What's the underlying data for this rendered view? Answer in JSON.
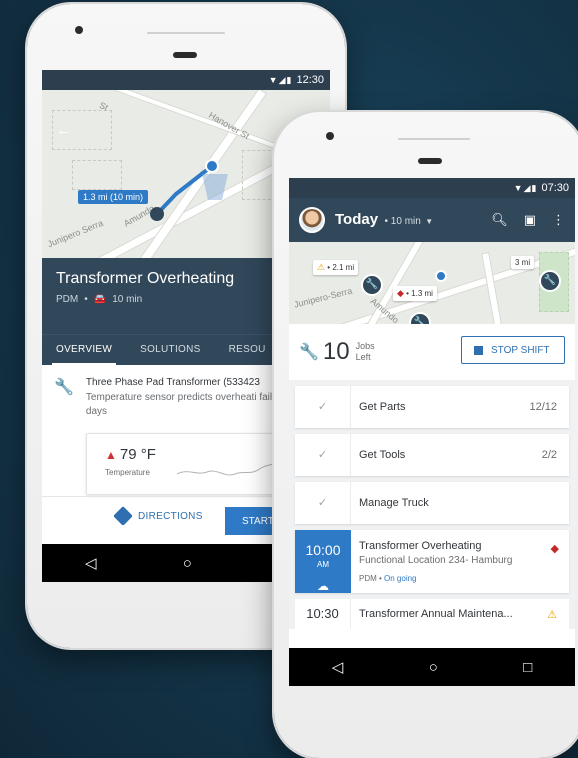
{
  "back_phone": {
    "status": {
      "icons": "▼◢▮",
      "time": "12:30"
    },
    "map": {
      "route_label": "1.3 mi (10 min)",
      "streets": [
        "Hanover St",
        "Junipero Serra",
        "Amundo",
        "St"
      ]
    },
    "header": {
      "title": "Transformer Overheating",
      "subtitle_org": "PDM",
      "subtitle_eta": "10 min"
    },
    "tabs": [
      "OVERVIEW",
      "SOLUTIONS",
      "RESOU"
    ],
    "asset": {
      "title": "Three Phase Pad Transformer (533423",
      "desc": "Temperature sensor predicts overheati failure in 4 days"
    },
    "temperature": {
      "value": "79 °F",
      "label": "Temperature"
    },
    "actions": {
      "directions": "DIRECTIONS",
      "start": "START"
    },
    "navbar": {
      "back": "◁",
      "home": "○",
      "recents": "□"
    }
  },
  "front_phone": {
    "status": {
      "icons": "▼◢▮",
      "time": "07:30"
    },
    "appbar": {
      "title": "Today",
      "eta": "10 min"
    },
    "map": {
      "dist_warn": "2.1 mi",
      "dist_err": "1.3 mi",
      "dist_right": "3 mi",
      "streets": [
        "Junipero-Serra",
        "Amundo"
      ]
    },
    "summary": {
      "count": "10",
      "label_top": "Jobs",
      "label_bottom": "Left",
      "stop_shift": "STOP SHIFT"
    },
    "tasks": [
      {
        "name": "Get Parts",
        "count": "12/12"
      },
      {
        "name": "Get Tools",
        "count": "2/2"
      },
      {
        "name": "Manage Truck",
        "count": ""
      }
    ],
    "job": {
      "time": "10:00",
      "ampm": "AM",
      "title": "Transformer Overheating",
      "location": "Functional Location 234- Hamburg",
      "org": "PDM",
      "state": "On going"
    },
    "job2": {
      "time": "10:30",
      "title": "Transformer Annual Maintena..."
    },
    "navbar": {
      "back": "◁",
      "home": "○",
      "recents": "□"
    }
  },
  "colors": {
    "header": "#31475a",
    "accent": "#2f7ac6",
    "warning": "#e9a400",
    "error": "#c62828",
    "background": "#15374c"
  }
}
